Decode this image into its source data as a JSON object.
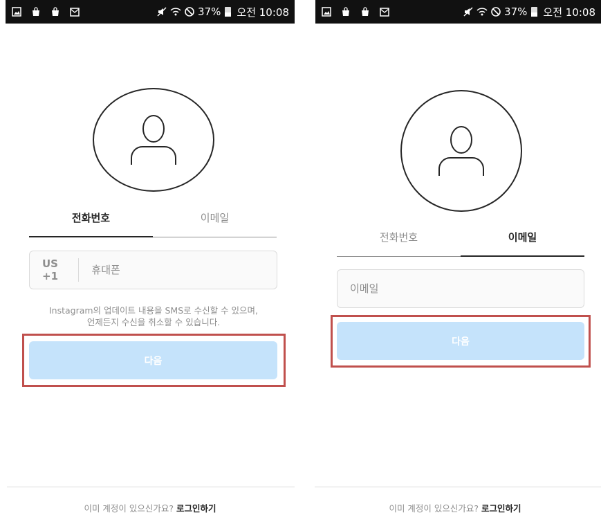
{
  "statusbar": {
    "battery_percent": "37%",
    "time": "오전 10:08",
    "left_icons": [
      "gallery-icon",
      "shopping-bag-icon",
      "shopping-bag-icon",
      "mail-icon"
    ],
    "right_icons": [
      "mute-icon",
      "wifi-icon",
      "blocked-icon",
      "battery-icon"
    ]
  },
  "phone_screen": {
    "tabs": [
      "전화번호",
      "이메일"
    ],
    "active_tab": "전화번호",
    "country_code": "US +1",
    "phone_placeholder": "휴대폰",
    "sms_note_line1": "Instagram의 업데이트 내용을 SMS로 수신할 수 있으며,",
    "sms_note_line2": "언제든지 수신을 취소할 수 있습니다.",
    "next_button": "다음"
  },
  "email_screen": {
    "tabs": [
      "전화번호",
      "이메일"
    ],
    "active_tab": "이메일",
    "email_placeholder": "이메일",
    "next_button": "다음"
  },
  "footer": {
    "question": "이미 계정이 있으신가요?",
    "login_link": "로그인하기"
  },
  "colors": {
    "button_disabled": "#c5e3fb",
    "highlight_box": "#c0504d",
    "text_primary": "#262626",
    "text_secondary": "#8e8e8e"
  }
}
